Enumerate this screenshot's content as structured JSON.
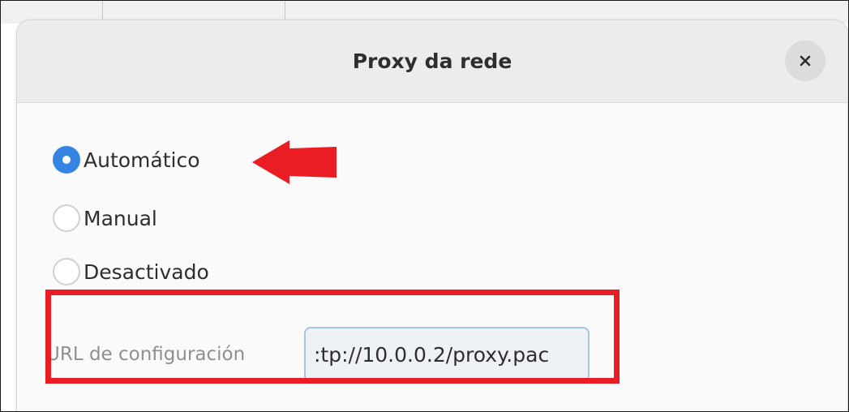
{
  "dialog": {
    "title": "Proxy da rede",
    "close_icon": "close-icon"
  },
  "proxy_modes": [
    {
      "label": "Automático",
      "selected": true
    },
    {
      "label": "Manual",
      "selected": false
    },
    {
      "label": "Desactivado",
      "selected": false
    }
  ],
  "config_url": {
    "label": "URL de configuración",
    "value": ":tp://10.0.0.2/proxy.pac"
  },
  "annotations": {
    "arrow_color": "#ea1c24",
    "box_color": "#ea1c24"
  },
  "colors": {
    "accent": "#3584e4"
  }
}
